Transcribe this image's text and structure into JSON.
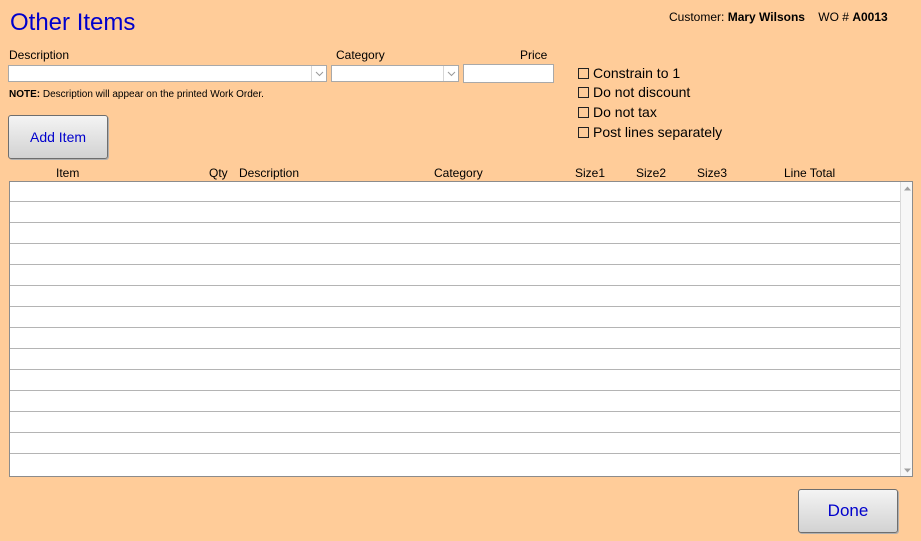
{
  "window": {
    "title": "Other Items",
    "customer_label": "Customer:",
    "customer_name": "Mary Wilsons",
    "wo_label": "WO #",
    "wo_number": "A0013"
  },
  "form": {
    "description_label": "Description",
    "category_label": "Category",
    "price_label": "Price",
    "description_value": "",
    "category_value": "",
    "price_value": "",
    "note_bold": "NOTE:",
    "note_text": " Description will appear on the printed Work Order.",
    "add_item_label": "Add Item"
  },
  "options": [
    {
      "label": "Constrain to 1",
      "checked": false
    },
    {
      "label": "Do not discount",
      "checked": false
    },
    {
      "label": "Do not tax",
      "checked": false
    },
    {
      "label": "Post lines separately",
      "checked": false
    }
  ],
  "table": {
    "columns": [
      "Item",
      "Qty",
      "Description",
      "Category",
      "Size1",
      "Size2",
      "Size3",
      "Line Total"
    ],
    "rows": []
  },
  "footer": {
    "done_label": "Done"
  },
  "colors": {
    "background": "#FFCC99",
    "accent": "#0000CC"
  }
}
